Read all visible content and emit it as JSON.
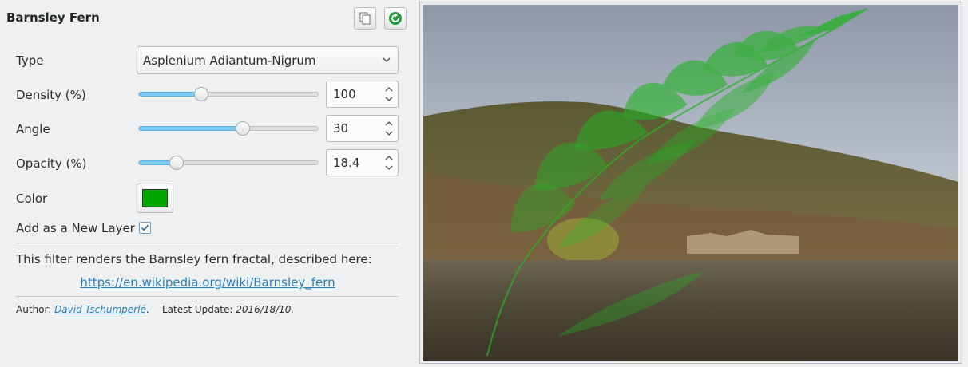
{
  "panel": {
    "title": "Barnsley Fern",
    "copy_icon": "copy-icon",
    "refresh_icon": "refresh-icon"
  },
  "type": {
    "label": "Type",
    "value": "Asplenium Adiantum-Nigrum"
  },
  "density": {
    "label": "Density (%)",
    "value": "100",
    "slider_fraction": 0.35
  },
  "angle": {
    "label": "Angle",
    "value": "30",
    "slider_fraction": 0.58
  },
  "opacity": {
    "label": "Opacity (%)",
    "value": "18.4",
    "slider_fraction": 0.21
  },
  "color": {
    "label": "Color",
    "value": "#00a600"
  },
  "new_layer": {
    "label": "Add as a New Layer",
    "checked": true
  },
  "description": {
    "text": "This filter renders the Barnsley fern fractal, described here:",
    "link": "https://en.wikipedia.org/wiki/Barnsley_fern"
  },
  "meta": {
    "author_label": "Author:",
    "author": "David Tschumperlé",
    "author_suffix": ".",
    "update_label": "Latest Update:",
    "update_value": "2016/18/10."
  },
  "preview": {
    "description_colors": {
      "sky": "#aab3bf",
      "hill": "#6b6a3c",
      "water": "#4a4233",
      "fern": "#22b422"
    }
  }
}
